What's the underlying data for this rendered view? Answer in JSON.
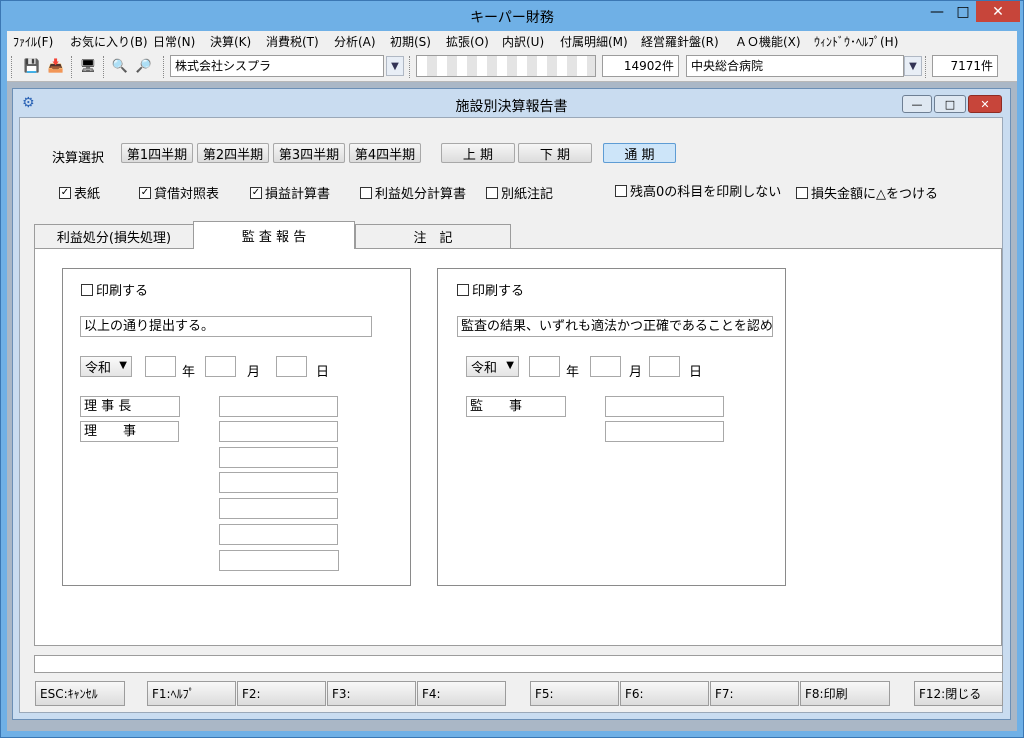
{
  "app": {
    "title": "キーパー財務"
  },
  "menu": [
    "ﾌｧｲﾙ(F)",
    "お気に入り(B)",
    "日常(N)",
    "決算(K)",
    "消費税(T)",
    "分析(A)",
    "初期(S)",
    "拡張(O)",
    "内訳(U)",
    "付属明細(M)",
    "経営羅針盤(R)",
    "ＡＯ機能(X)",
    "ｳｨﾝﾄﾞｳ･ﾍﾙﾌﾟ(H)"
  ],
  "toolbar": {
    "company": "株式会社シスプラ",
    "redacted": "",
    "count1": "14902件",
    "hospital": "中央総合病院",
    "count2": "7171件"
  },
  "form": {
    "title": "施設別決算報告書",
    "period_label": "決算選択",
    "periods": [
      "第1四半期",
      "第2四半期",
      "第3四半期",
      "第4四半期"
    ],
    "halves": [
      "上 期",
      "下 期",
      "通 期"
    ],
    "options": [
      {
        "label": "表紙",
        "checked": true
      },
      {
        "label": "貸借対照表",
        "checked": true
      },
      {
        "label": "損益計算書",
        "checked": true
      },
      {
        "label": "利益処分計算書",
        "checked": false
      },
      {
        "label": "別紙注記",
        "checked": false
      },
      {
        "label": "残高0の科目を印刷しない",
        "checked": false
      },
      {
        "label": "損失金額に△をつける",
        "checked": false
      }
    ],
    "tabs": [
      "利益処分(損失処理)",
      "監 査 報 告",
      "注　記"
    ],
    "left": {
      "print_label": "印刷する",
      "statement": "以上の通り提出する。",
      "era": "令和",
      "year": "年",
      "month": "月",
      "day": "日",
      "role1": "理 事 長",
      "role2": "理　　事"
    },
    "right": {
      "print_label": "印刷する",
      "statement": "監査の結果、いずれも適法かつ正確であることを認める。",
      "era": "令和",
      "year": "年",
      "month": "月",
      "day": "日",
      "role1": "監　　事"
    }
  },
  "fkeys": [
    "ESC:ｷｬﾝｾﾙ",
    "F1:ﾍﾙﾌﾟ",
    "F2:",
    "F3:",
    "F4:",
    "F5:",
    "F6:",
    "F7:",
    "F8:印刷",
    "F12:閉じる"
  ]
}
